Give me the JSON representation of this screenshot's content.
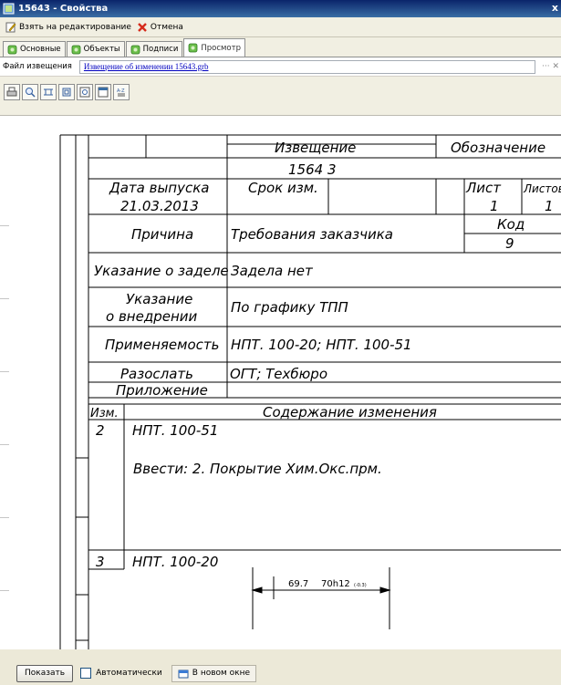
{
  "window": {
    "title": "15643 - Свойства",
    "close": "x"
  },
  "toolbar": {
    "edit_label": "Взять на редактирование",
    "cancel_label": "Отмена"
  },
  "tabs": [
    {
      "label": "Основные"
    },
    {
      "label": "Объекты"
    },
    {
      "label": "Подписи"
    },
    {
      "label": "Просмотр"
    }
  ],
  "file": {
    "label": "Файл извещения",
    "value": "Извещение об изменении 15643.grb",
    "buttons": "··· ✕"
  },
  "doc": {
    "izveshchenie": "Извещение",
    "oboznachenie": "Обозначение",
    "number": "1564 3",
    "data_vypuska_label": "Дата выпуска",
    "data_vypuska": "21.03.2013",
    "srok_label": "Срок изм.",
    "list_label": "Лист",
    "listov_label": "Листов",
    "list": "1",
    "listov": "1",
    "prichina_label": "Причина",
    "prichina": "Требования заказчика",
    "kod_label": "Код",
    "kod": "9",
    "zadel_label": "Указание о заделе",
    "zadel": "Задела нет",
    "vnedrenie_label_1": "Указание",
    "vnedrenie_label_2": "о внедрении",
    "vnedrenie": "По графику ТПП",
    "primenyaemost_label": "Применяемость",
    "primenyaemost": "НПТ. 100-20; НПТ. 100-51",
    "razoslat_label": "Разослать",
    "razoslat": "ОГТ; Техбюро",
    "prilozhenie_label": "Приложение",
    "izm_label": "Изм.",
    "soderzhanie_label": "Содержание изменения",
    "row1_num": "2",
    "row1_doc": "НПТ. 100-51",
    "row1_text": "Ввести:   2. Покрытие Хим.Окс.прм.",
    "row2_num": "3",
    "row2_doc": "НПТ. 100-20",
    "dim_old": "69.7",
    "dim_new": "70h12",
    "dim_tol": "(-0.3)"
  },
  "bottom": {
    "show": "Показать",
    "auto": "Автоматически",
    "new_window": "В новом окне"
  }
}
